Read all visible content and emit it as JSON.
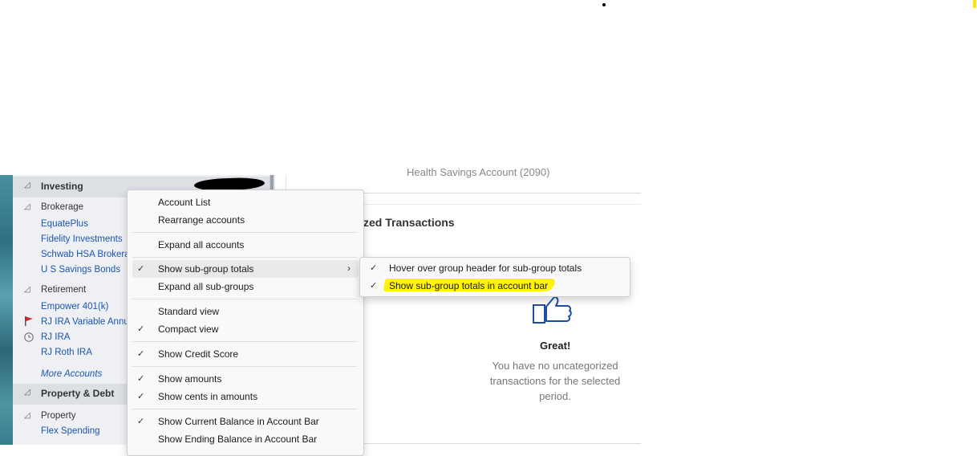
{
  "sidebar": {
    "groups": [
      {
        "label": "Investing"
      },
      {
        "label": "Property & Debt"
      }
    ],
    "subgroups": [
      {
        "label": "Brokerage"
      },
      {
        "label": "Retirement"
      },
      {
        "label": "Property"
      }
    ],
    "accounts": [
      "EquatePlus",
      "Fidelity Investments",
      "Schwab HSA Brokera",
      "U S Savings Bonds",
      "Empower 401(k)",
      "RJ IRA Variable Annu",
      "RJ IRA",
      "RJ Roth IRA",
      "Flex Spending"
    ],
    "more_accounts": "More Accounts"
  },
  "main": {
    "cut_text": "Health Savings Account (2090)",
    "section_title": "zed Transactions",
    "great": "Great!",
    "empty_message": "You have no uncategorized transactions for the selected period."
  },
  "menu": {
    "items": [
      {
        "label": "Account List",
        "checked": false
      },
      {
        "label": "Rearrange accounts",
        "checked": false
      },
      {
        "label": "Expand all accounts",
        "checked": false
      },
      {
        "label": "Show sub-group totals",
        "checked": true,
        "submenu": true
      },
      {
        "label": "Expand all sub-groups",
        "checked": false
      },
      {
        "label": "Standard view",
        "checked": false
      },
      {
        "label": "Compact view",
        "checked": true
      },
      {
        "label": "Show Credit Score",
        "checked": true
      },
      {
        "label": "Show amounts",
        "checked": true
      },
      {
        "label": "Show cents in amounts",
        "checked": true
      },
      {
        "label": "Show Current Balance in Account Bar",
        "checked": true
      },
      {
        "label": "Show Ending Balance in Account Bar",
        "checked": false
      }
    ],
    "check_glyph": "✓",
    "arrow_glyph": "›"
  },
  "submenu": {
    "items": [
      {
        "label": "Hover over group header for sub-group totals",
        "checked": true
      },
      {
        "label": "Show sub-group totals in account bar",
        "checked": true
      }
    ]
  },
  "colors": {
    "link": "#1a56b0",
    "highlight": "#fff200",
    "flag": "#d9252a",
    "icon_blue": "#1f4fa3"
  },
  "icons": {
    "expand": "▲",
    "flag": "flag-icon",
    "clock": "clock-icon",
    "thumbs_up": "thumbs-up-icon"
  }
}
